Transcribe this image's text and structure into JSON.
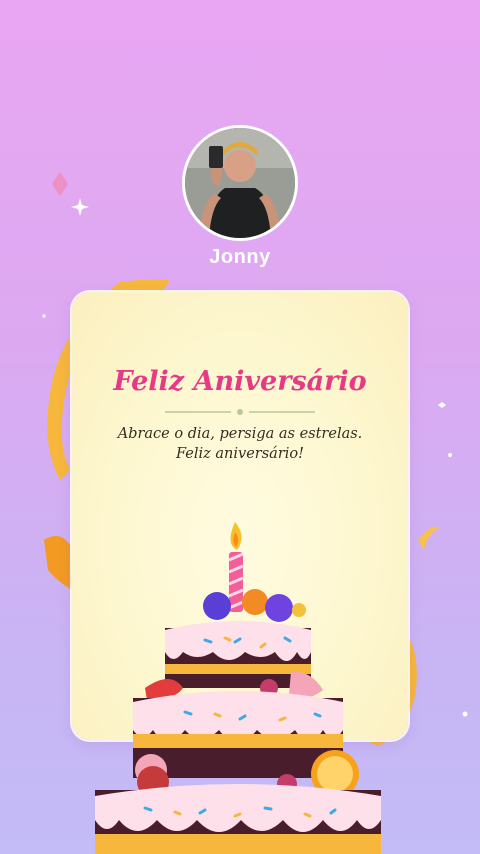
{
  "profile": {
    "name": "Jonny",
    "avatar_icon": "person-photo"
  },
  "card": {
    "title": "Feliz Aniversário",
    "message": "Abrace o dia, persiga as estrelas. Feliz aniversário!"
  },
  "colors": {
    "title": "#e63a86",
    "background_top": "#e9a6f3",
    "background_bottom": "#c3bcf6",
    "card": "#fdf7cf",
    "ribbon": "#f6b73c"
  }
}
